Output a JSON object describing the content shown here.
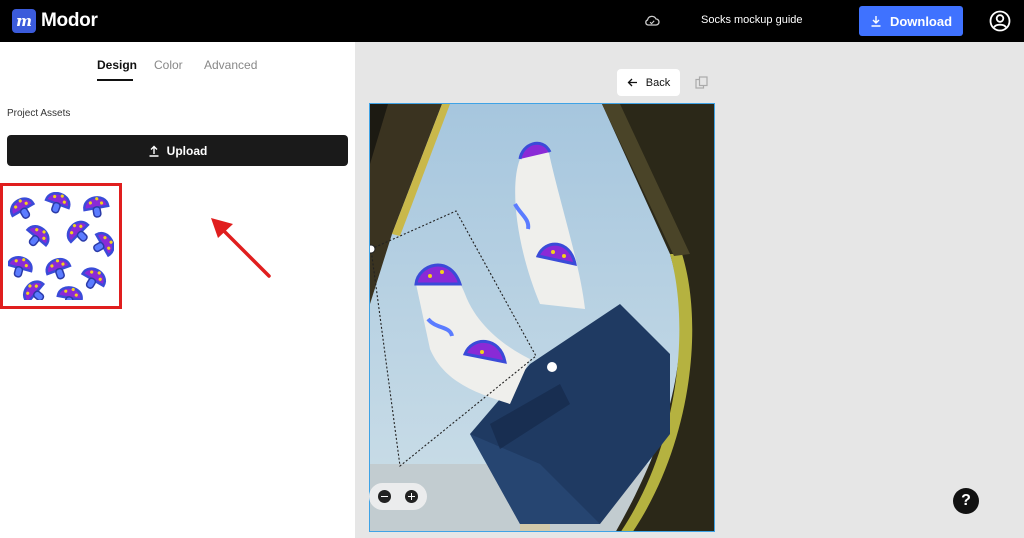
{
  "header": {
    "app_name": "Modor",
    "logo_glyph": "m",
    "guide_label": "Socks mockup guide",
    "download_label": "Download"
  },
  "tabs": [
    {
      "label": "Design",
      "active": true
    },
    {
      "label": "Color",
      "active": false
    },
    {
      "label": "Advanced",
      "active": false
    }
  ],
  "assets": {
    "section_label": "Project Assets",
    "upload_label": "Upload"
  },
  "canvas": {
    "back_label": "Back"
  },
  "help": {
    "label": "?"
  },
  "colors": {
    "brand": "#3b5bdb",
    "download": "#3f72ff",
    "highlight": "#e01e1e",
    "selection": "#3fa3e6"
  },
  "icons": {
    "cloud": "cloud-icon",
    "download": "download-icon",
    "account": "account-icon",
    "upload": "upload-icon",
    "back": "arrow-left-icon",
    "copy": "copy-icon",
    "help": "question-icon"
  }
}
